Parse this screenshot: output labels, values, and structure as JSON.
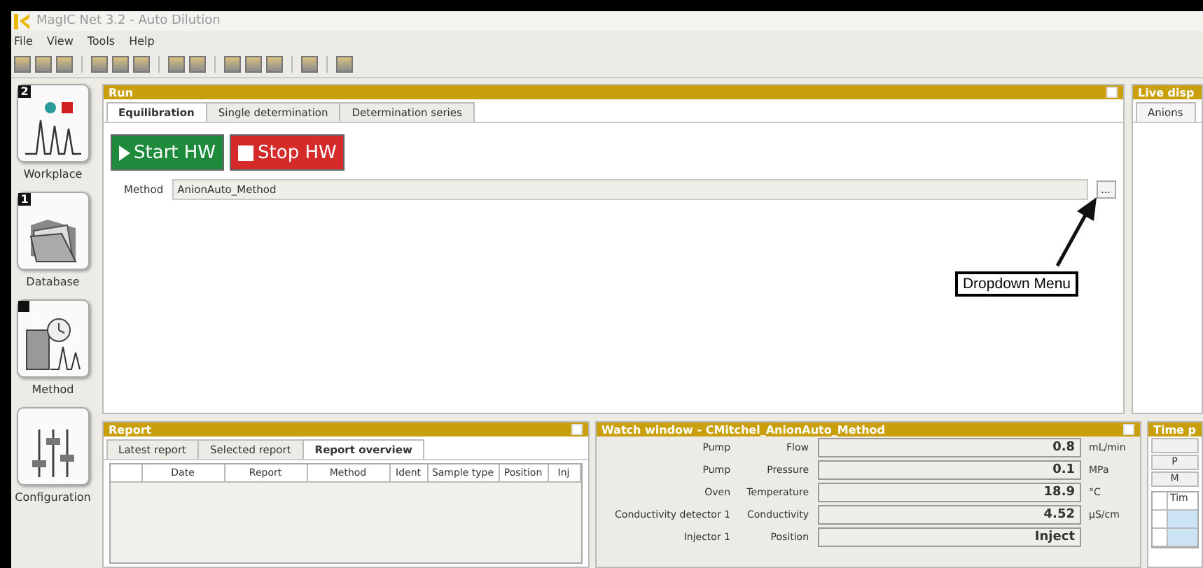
{
  "window": {
    "title": "MagIC Net 3.2 - Auto Dilution"
  },
  "menu": [
    "File",
    "View",
    "Tools",
    "Help"
  ],
  "sidebar": [
    {
      "label": "Workplace",
      "badge": "2",
      "kind": "workplace"
    },
    {
      "label": "Database",
      "badge": "1",
      "kind": "database"
    },
    {
      "label": "Method",
      "kind": "method"
    },
    {
      "label": "Configuration",
      "kind": "configuration"
    }
  ],
  "run": {
    "title": "Run",
    "tabs": [
      {
        "label": "Equilibration",
        "selected": true
      },
      {
        "label": "Single determination",
        "selected": false
      },
      {
        "label": "Determination series",
        "selected": false
      }
    ],
    "start_button": "Start HW",
    "stop_button": "Stop HW",
    "method_label": "Method",
    "method_value": "AnionAuto_Method",
    "browse_button": "...",
    "annotation": "Dropdown Menu"
  },
  "live_display": {
    "title": "Live disp",
    "tabs": [
      {
        "label": "Anions",
        "selected": true
      }
    ]
  },
  "report": {
    "title": "Report",
    "tabs": [
      {
        "label": "Latest report",
        "selected": false
      },
      {
        "label": "Selected report",
        "selected": false
      },
      {
        "label": "Report overview",
        "selected": true
      }
    ],
    "columns": [
      "Date",
      "Report",
      "Method",
      "Ident",
      "Sample type",
      "Position",
      "Inj"
    ]
  },
  "watch": {
    "title": "Watch window - CMitchel_AnionAuto_Method",
    "rows": [
      {
        "device": "Pump",
        "parameter": "Flow",
        "value": "0.8",
        "unit": "mL/min"
      },
      {
        "device": "Pump",
        "parameter": "Pressure",
        "value": "0.1",
        "unit": "MPa"
      },
      {
        "device": "Oven",
        "parameter": "Temperature",
        "value": "18.9",
        "unit": "°C"
      },
      {
        "device": "Conductivity detector 1",
        "parameter": "Conductivity",
        "value": "4.52",
        "unit": "µS/cm"
      },
      {
        "device": "Injector 1",
        "parameter": "Position",
        "value": "Inject"
      }
    ]
  },
  "time_panel": {
    "title": "Time p",
    "buttons": [
      "P",
      "M"
    ],
    "column": "Tim"
  }
}
